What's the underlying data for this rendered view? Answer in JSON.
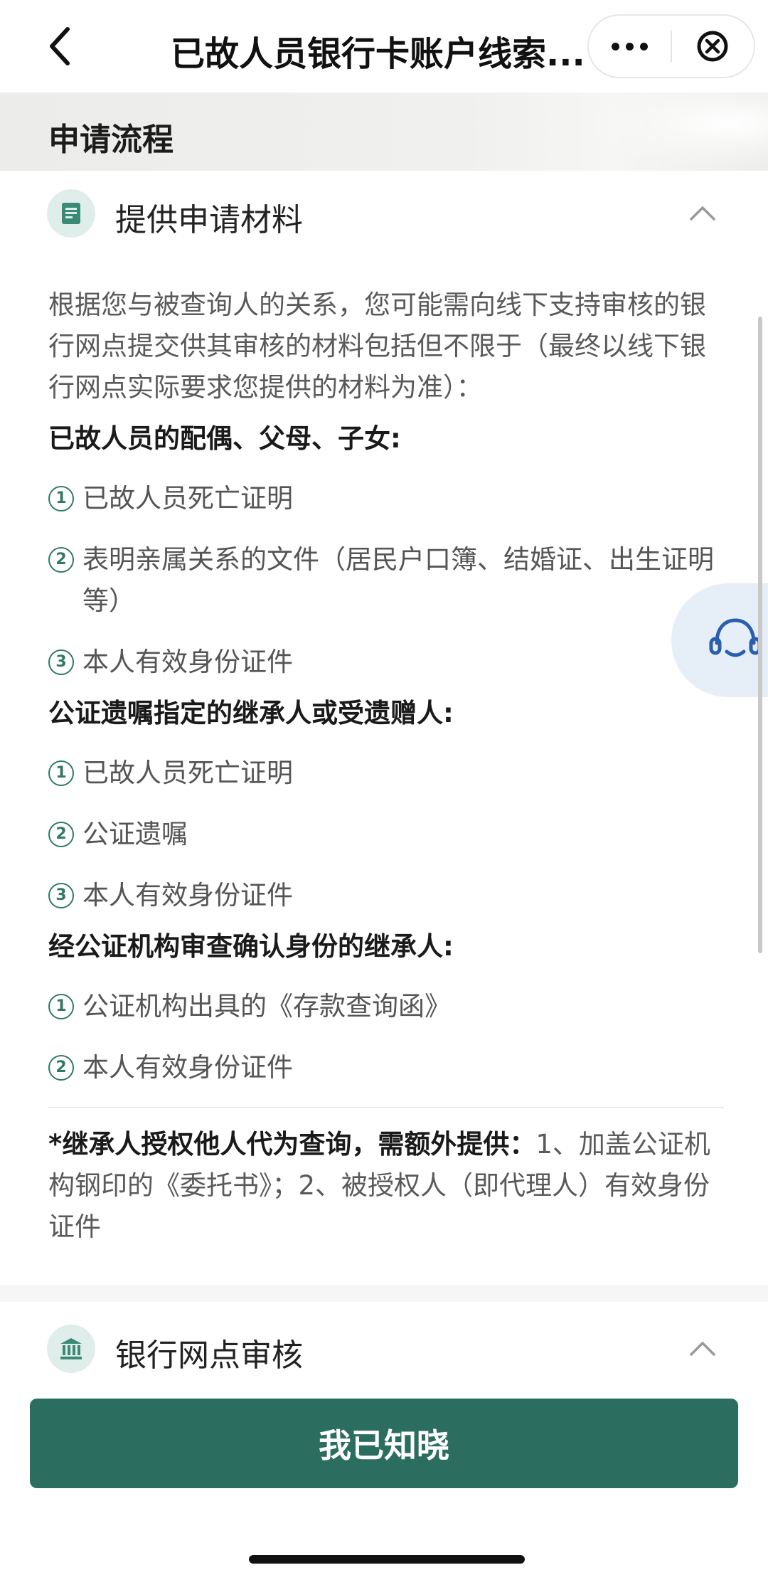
{
  "nav": {
    "title": "已故人员银行卡账户线索..."
  },
  "section": {
    "title": "申请流程"
  },
  "step1": {
    "title": "提供申请材料",
    "intro": "根据您与被查询人的关系，您可能需向线下支持审核的银行网点提交供其审核的材料包括但不限于（最终以线下银行网点实际要求您提供的材料为准）：",
    "groups": [
      {
        "title": "已故人员的配偶、父母、子女:",
        "items": [
          {
            "num": "1",
            "text": "已故人员死亡证明"
          },
          {
            "num": "2",
            "text": "表明亲属关系的文件（居民户口簿、结婚证、出生证明等）"
          },
          {
            "num": "3",
            "text": "本人有效身份证件"
          }
        ]
      },
      {
        "title": "公证遗嘱指定的继承人或受遗赠人:",
        "items": [
          {
            "num": "1",
            "text": "已故人员死亡证明"
          },
          {
            "num": "2",
            "text": "公证遗嘱"
          },
          {
            "num": "3",
            "text": "本人有效身份证件"
          }
        ]
      },
      {
        "title": "经公证机构审查确认身份的继承人:",
        "items": [
          {
            "num": "1",
            "text": "公证机构出具的《存款查询函》"
          },
          {
            "num": "2",
            "text": "本人有效身份证件"
          }
        ]
      }
    ],
    "note_bold": "*继承人授权他人代为查询，需额外提供：",
    "note_text": "1、加盖公证机构钢印的《委托书》；2、被授权人（即代理人）有效身份证件"
  },
  "step2": {
    "title": "银行网点审核"
  },
  "button": {
    "label": "我已知晓"
  },
  "colors": {
    "accent": "#2b6e5f",
    "number_circle": "#2f7a66",
    "icon_bg": "#dfeeea",
    "cs_bg": "#e6eef8"
  },
  "icons": {
    "back": "chevron-left-icon",
    "more": "more-dots-icon",
    "close": "close-circle-icon",
    "step1": "document-icon",
    "step2": "bank-icon",
    "collapse": "chevron-up-icon",
    "support": "customer-service-icon"
  }
}
